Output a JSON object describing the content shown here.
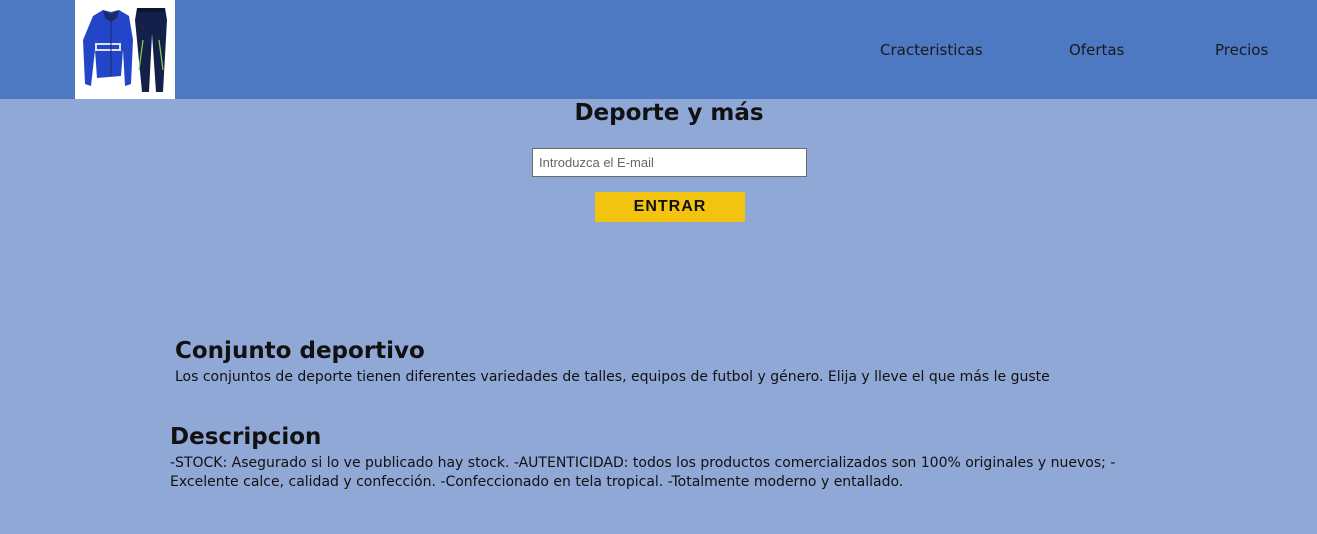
{
  "header": {
    "logo_alt": "Conjunto deportivo",
    "nav": [
      {
        "label": "Cracteristicas"
      },
      {
        "label": "Ofertas"
      },
      {
        "label": "Precios"
      }
    ]
  },
  "hero": {
    "title": "Deporte y más",
    "email_placeholder": "Introduzca el E-mail",
    "email_value": "",
    "enter_label": "ENTRAR"
  },
  "product": {
    "title": "Conjunto deportivo",
    "text": "Los conjuntos de deporte tienen diferentes variedades de talles, equipos de futbol y género. Elija y lleve el que más le guste"
  },
  "description": {
    "title": "Descripcion",
    "text": "-STOCK: Asegurado si lo ve publicado hay stock. -AUTENTICIDAD: todos los productos comercializados son 100% originales y nuevos; -Excelente calce, calidad y confección. -Confeccionado en tela tropical. -Totalmente moderno y entallado."
  },
  "colors": {
    "header_bg": "#4d78c2",
    "page_bg": "#8fa8d6",
    "button_bg": "#f2c40f"
  }
}
